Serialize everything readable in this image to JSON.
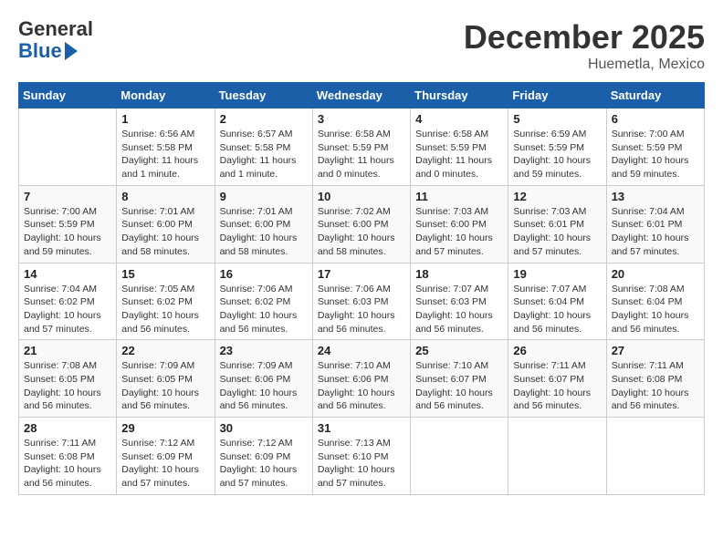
{
  "header": {
    "logo_line1": "General",
    "logo_line2": "Blue",
    "month": "December 2025",
    "location": "Huemetla, Mexico"
  },
  "days_of_week": [
    "Sunday",
    "Monday",
    "Tuesday",
    "Wednesday",
    "Thursday",
    "Friday",
    "Saturday"
  ],
  "weeks": [
    [
      {
        "day": "",
        "info": ""
      },
      {
        "day": "1",
        "info": "Sunrise: 6:56 AM\nSunset: 5:58 PM\nDaylight: 11 hours\nand 1 minute."
      },
      {
        "day": "2",
        "info": "Sunrise: 6:57 AM\nSunset: 5:58 PM\nDaylight: 11 hours\nand 1 minute."
      },
      {
        "day": "3",
        "info": "Sunrise: 6:58 AM\nSunset: 5:59 PM\nDaylight: 11 hours\nand 0 minutes."
      },
      {
        "day": "4",
        "info": "Sunrise: 6:58 AM\nSunset: 5:59 PM\nDaylight: 11 hours\nand 0 minutes."
      },
      {
        "day": "5",
        "info": "Sunrise: 6:59 AM\nSunset: 5:59 PM\nDaylight: 10 hours\nand 59 minutes."
      },
      {
        "day": "6",
        "info": "Sunrise: 7:00 AM\nSunset: 5:59 PM\nDaylight: 10 hours\nand 59 minutes."
      }
    ],
    [
      {
        "day": "7",
        "info": "Sunrise: 7:00 AM\nSunset: 5:59 PM\nDaylight: 10 hours\nand 59 minutes."
      },
      {
        "day": "8",
        "info": "Sunrise: 7:01 AM\nSunset: 6:00 PM\nDaylight: 10 hours\nand 58 minutes."
      },
      {
        "day": "9",
        "info": "Sunrise: 7:01 AM\nSunset: 6:00 PM\nDaylight: 10 hours\nand 58 minutes."
      },
      {
        "day": "10",
        "info": "Sunrise: 7:02 AM\nSunset: 6:00 PM\nDaylight: 10 hours\nand 58 minutes."
      },
      {
        "day": "11",
        "info": "Sunrise: 7:03 AM\nSunset: 6:00 PM\nDaylight: 10 hours\nand 57 minutes."
      },
      {
        "day": "12",
        "info": "Sunrise: 7:03 AM\nSunset: 6:01 PM\nDaylight: 10 hours\nand 57 minutes."
      },
      {
        "day": "13",
        "info": "Sunrise: 7:04 AM\nSunset: 6:01 PM\nDaylight: 10 hours\nand 57 minutes."
      }
    ],
    [
      {
        "day": "14",
        "info": "Sunrise: 7:04 AM\nSunset: 6:02 PM\nDaylight: 10 hours\nand 57 minutes."
      },
      {
        "day": "15",
        "info": "Sunrise: 7:05 AM\nSunset: 6:02 PM\nDaylight: 10 hours\nand 56 minutes."
      },
      {
        "day": "16",
        "info": "Sunrise: 7:06 AM\nSunset: 6:02 PM\nDaylight: 10 hours\nand 56 minutes."
      },
      {
        "day": "17",
        "info": "Sunrise: 7:06 AM\nSunset: 6:03 PM\nDaylight: 10 hours\nand 56 minutes."
      },
      {
        "day": "18",
        "info": "Sunrise: 7:07 AM\nSunset: 6:03 PM\nDaylight: 10 hours\nand 56 minutes."
      },
      {
        "day": "19",
        "info": "Sunrise: 7:07 AM\nSunset: 6:04 PM\nDaylight: 10 hours\nand 56 minutes."
      },
      {
        "day": "20",
        "info": "Sunrise: 7:08 AM\nSunset: 6:04 PM\nDaylight: 10 hours\nand 56 minutes."
      }
    ],
    [
      {
        "day": "21",
        "info": "Sunrise: 7:08 AM\nSunset: 6:05 PM\nDaylight: 10 hours\nand 56 minutes."
      },
      {
        "day": "22",
        "info": "Sunrise: 7:09 AM\nSunset: 6:05 PM\nDaylight: 10 hours\nand 56 minutes."
      },
      {
        "day": "23",
        "info": "Sunrise: 7:09 AM\nSunset: 6:06 PM\nDaylight: 10 hours\nand 56 minutes."
      },
      {
        "day": "24",
        "info": "Sunrise: 7:10 AM\nSunset: 6:06 PM\nDaylight: 10 hours\nand 56 minutes."
      },
      {
        "day": "25",
        "info": "Sunrise: 7:10 AM\nSunset: 6:07 PM\nDaylight: 10 hours\nand 56 minutes."
      },
      {
        "day": "26",
        "info": "Sunrise: 7:11 AM\nSunset: 6:07 PM\nDaylight: 10 hours\nand 56 minutes."
      },
      {
        "day": "27",
        "info": "Sunrise: 7:11 AM\nSunset: 6:08 PM\nDaylight: 10 hours\nand 56 minutes."
      }
    ],
    [
      {
        "day": "28",
        "info": "Sunrise: 7:11 AM\nSunset: 6:08 PM\nDaylight: 10 hours\nand 56 minutes."
      },
      {
        "day": "29",
        "info": "Sunrise: 7:12 AM\nSunset: 6:09 PM\nDaylight: 10 hours\nand 57 minutes."
      },
      {
        "day": "30",
        "info": "Sunrise: 7:12 AM\nSunset: 6:09 PM\nDaylight: 10 hours\nand 57 minutes."
      },
      {
        "day": "31",
        "info": "Sunrise: 7:13 AM\nSunset: 6:10 PM\nDaylight: 10 hours\nand 57 minutes."
      },
      {
        "day": "",
        "info": ""
      },
      {
        "day": "",
        "info": ""
      },
      {
        "day": "",
        "info": ""
      }
    ]
  ]
}
